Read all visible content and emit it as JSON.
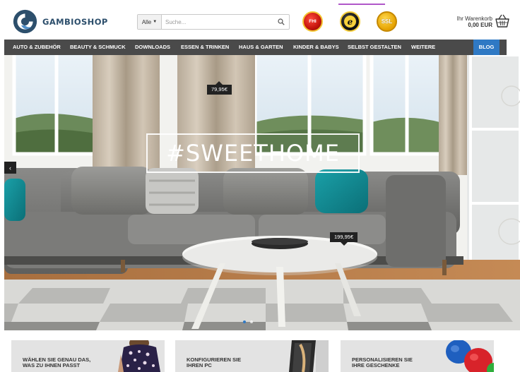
{
  "brand": {
    "name": "GAMBIOSHOP"
  },
  "search": {
    "category": "Alle",
    "placeholder": "Suche..."
  },
  "badges": {
    "fhi": "FHI",
    "trusted": "e",
    "ssl": "SSL"
  },
  "cart": {
    "label": "Ihr Warenkorb",
    "total": "0,00 EUR"
  },
  "nav": {
    "items": [
      "AUTO & ZUBEHÖR",
      "BEAUTY & SCHMUCK",
      "DOWNLOADS",
      "ESSEN & TRINKEN",
      "HAUS & GARTEN",
      "KINDER & BABYS",
      "SELBST GESTALTEN",
      "WEITERE"
    ],
    "blog": "BLOG"
  },
  "hero": {
    "title": "#SWEETHOME",
    "price_1": "79,95€",
    "price_2": "199,95€",
    "prev": "‹",
    "active_slide": 1
  },
  "promos": [
    {
      "line1": "WÄHLEN SIE GENAU DAS,",
      "line2": "WAS ZU IHNEN PASST"
    },
    {
      "line1": "KONFIGURIEREN SIE",
      "line2": "IHREN PC"
    },
    {
      "line1": "PERSONALISIEREN SIE",
      "line2": "IHRE GESCHENKE"
    }
  ],
  "colors": {
    "nav_bg": "#4a4a4a",
    "blog_bg": "#2f79c4",
    "logo_blue": "#2d4f6c"
  }
}
